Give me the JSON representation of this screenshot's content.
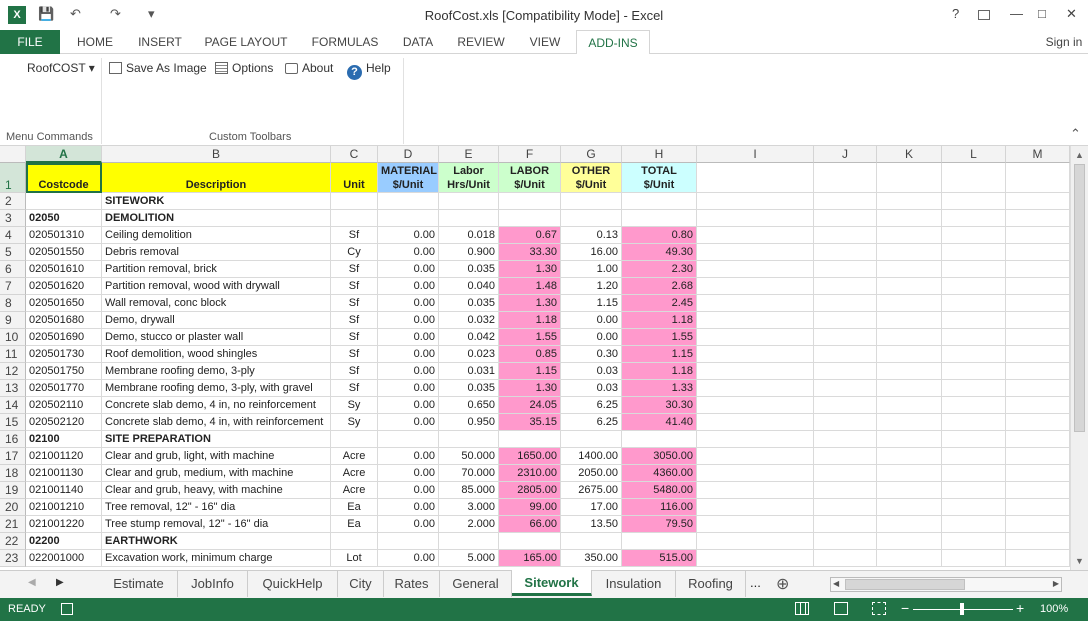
{
  "app": {
    "title": "RoofCost.xls  [Compatibility Mode] - Excel",
    "signin": "Sign in",
    "logo_letter": "X",
    "help_glyph": "?",
    "minimize": "—",
    "maximize": "□",
    "close": "✕"
  },
  "quick_access": {
    "save": "💾",
    "undo": "↶",
    "redo": "↷",
    "customize": "▾"
  },
  "ribbon_tabs": [
    "FILE",
    "HOME",
    "INSERT",
    "PAGE LAYOUT",
    "FORMULAS",
    "DATA",
    "REVIEW",
    "VIEW",
    "ADD-INS"
  ],
  "ribbon": {
    "roofcost": "RoofCOST",
    "save_as_image": "Save As Image",
    "options": "Options",
    "about": "About",
    "help": "Help",
    "group_menu": "Menu Commands",
    "group_custom": "Custom Toolbars",
    "collapse": "⌃"
  },
  "columns": [
    "A",
    "B",
    "C",
    "D",
    "E",
    "F",
    "G",
    "H",
    "I",
    "J",
    "K",
    "L",
    "M"
  ],
  "header": {
    "a": "Costcode",
    "b": "Description",
    "c": "Unit",
    "d1": "MATERIAL",
    "d2": "$/Unit",
    "e1": "Labor",
    "e2": "Hrs/Unit",
    "f1": "LABOR",
    "f2": "$/Unit",
    "g1": "OTHER",
    "g2": "$/Unit",
    "h1": "TOTAL",
    "h2": "$/Unit"
  },
  "rows": [
    [
      "2",
      "",
      "SITEWORK",
      "",
      "",
      "",
      "",
      "",
      ""
    ],
    [
      "3",
      "02050",
      "DEMOLITION",
      "",
      "",
      "",
      "",
      "",
      ""
    ],
    [
      "4",
      "020501310",
      "Ceiling demolition",
      "Sf",
      "0.00",
      "0.018",
      "0.67",
      "0.13",
      "0.80"
    ],
    [
      "5",
      "020501550",
      "Debris removal",
      "Cy",
      "0.00",
      "0.900",
      "33.30",
      "16.00",
      "49.30"
    ],
    [
      "6",
      "020501610",
      "Partition removal, brick",
      "Sf",
      "0.00",
      "0.035",
      "1.30",
      "1.00",
      "2.30"
    ],
    [
      "7",
      "020501620",
      "Partition removal, wood with drywall",
      "Sf",
      "0.00",
      "0.040",
      "1.48",
      "1.20",
      "2.68"
    ],
    [
      "8",
      "020501650",
      "Wall removal, conc block",
      "Sf",
      "0.00",
      "0.035",
      "1.30",
      "1.15",
      "2.45"
    ],
    [
      "9",
      "020501680",
      "Demo, drywall",
      "Sf",
      "0.00",
      "0.032",
      "1.18",
      "0.00",
      "1.18"
    ],
    [
      "10",
      "020501690",
      "Demo, stucco or plaster wall",
      "Sf",
      "0.00",
      "0.042",
      "1.55",
      "0.00",
      "1.55"
    ],
    [
      "11",
      "020501730",
      "Roof demolition, wood shingles",
      "Sf",
      "0.00",
      "0.023",
      "0.85",
      "0.30",
      "1.15"
    ],
    [
      "12",
      "020501750",
      "Membrane roofing demo, 3-ply",
      "Sf",
      "0.00",
      "0.031",
      "1.15",
      "0.03",
      "1.18"
    ],
    [
      "13",
      "020501770",
      "Membrane roofing demo, 3-ply, with gravel",
      "Sf",
      "0.00",
      "0.035",
      "1.30",
      "0.03",
      "1.33"
    ],
    [
      "14",
      "020502110",
      "Concrete slab demo, 4 in, no reinforcement",
      "Sy",
      "0.00",
      "0.650",
      "24.05",
      "6.25",
      "30.30"
    ],
    [
      "15",
      "020502120",
      "Concrete slab demo, 4 in, with reinforcement",
      "Sy",
      "0.00",
      "0.950",
      "35.15",
      "6.25",
      "41.40"
    ],
    [
      "16",
      "02100",
      "SITE PREPARATION",
      "",
      "",
      "",
      "",
      "",
      ""
    ],
    [
      "17",
      "021001120",
      "Clear and grub, light, with machine",
      "Acre",
      "0.00",
      "50.000",
      "1650.00",
      "1400.00",
      "3050.00"
    ],
    [
      "18",
      "021001130",
      "Clear and grub, medium, with machine",
      "Acre",
      "0.00",
      "70.000",
      "2310.00",
      "2050.00",
      "4360.00"
    ],
    [
      "19",
      "021001140",
      "Clear and grub, heavy, with machine",
      "Acre",
      "0.00",
      "85.000",
      "2805.00",
      "2675.00",
      "5480.00"
    ],
    [
      "20",
      "021001210",
      "Tree removal, 12\" - 16\" dia",
      "Ea",
      "0.00",
      "3.000",
      "99.00",
      "17.00",
      "116.00"
    ],
    [
      "21",
      "021001220",
      "Tree stump removal, 12\" - 16\" dia",
      "Ea",
      "0.00",
      "2.000",
      "66.00",
      "13.50",
      "79.50"
    ],
    [
      "22",
      "02200",
      "EARTHWORK",
      "",
      "",
      "",
      "",
      "",
      ""
    ],
    [
      "23",
      "022001000",
      "Excavation work, minimum charge",
      "Lot",
      "0.00",
      "5.000",
      "165.00",
      "350.00",
      "515.00"
    ]
  ],
  "sheet_tabs": [
    "Estimate",
    "JobInfo",
    "QuickHelp",
    "City",
    "Rates",
    "General",
    "Sitework",
    "Insulation",
    "Roofing"
  ],
  "active_sheet": "Sitework",
  "more_tabs": "...",
  "add_sheet": "⊕",
  "status": {
    "ready": "READY",
    "zoom": "100%",
    "minus": "−",
    "plus": "+"
  },
  "colors": {
    "excel_green": "#217346",
    "yellow": "#ffff00",
    "blue": "#99ccff",
    "green": "#ccffcc",
    "pink": "#ff99cc",
    "cyan": "#ccffff",
    "light_yellow": "#ffff99"
  }
}
